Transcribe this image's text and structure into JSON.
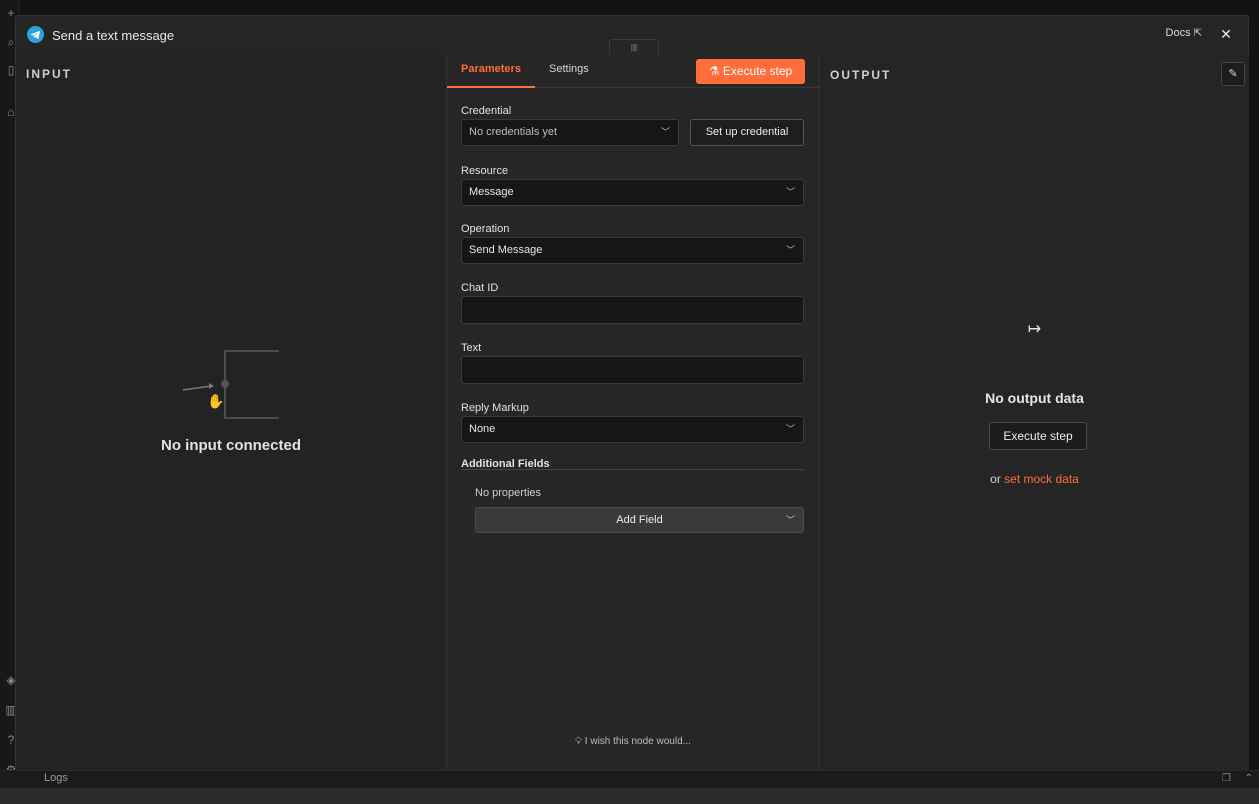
{
  "modal": {
    "title": "Send a text message",
    "docs_label": "Docs",
    "close_glyph": "✕"
  },
  "input_panel": {
    "label": "INPUT",
    "empty_text": "No input connected"
  },
  "parameters": {
    "tabs": [
      {
        "label": "Parameters",
        "active": true
      },
      {
        "label": "Settings",
        "active": false
      }
    ],
    "execute_label": "Execute step",
    "fields": {
      "credential_label": "Credential",
      "credential_value": "No credentials yet",
      "setup_credential_label": "Set up credential",
      "resource_label": "Resource",
      "resource_value": "Message",
      "operation_label": "Operation",
      "operation_value": "Send Message",
      "chat_id_label": "Chat ID",
      "text_label": "Text",
      "reply_markup_label": "Reply Markup",
      "reply_markup_value": "None",
      "additional_fields_label": "Additional Fields",
      "no_properties": "No properties",
      "add_field_label": "Add Field"
    },
    "wish_text": "I wish this node would..."
  },
  "output_panel": {
    "label": "OUTPUT",
    "empty_text": "No output data",
    "execute_label": "Execute step",
    "or_text": "or",
    "mock_link": "set mock data"
  },
  "footer": {
    "logs_label": "Logs"
  },
  "colors": {
    "accent": "#ff6d3a",
    "telegram": "#2aa3df"
  }
}
